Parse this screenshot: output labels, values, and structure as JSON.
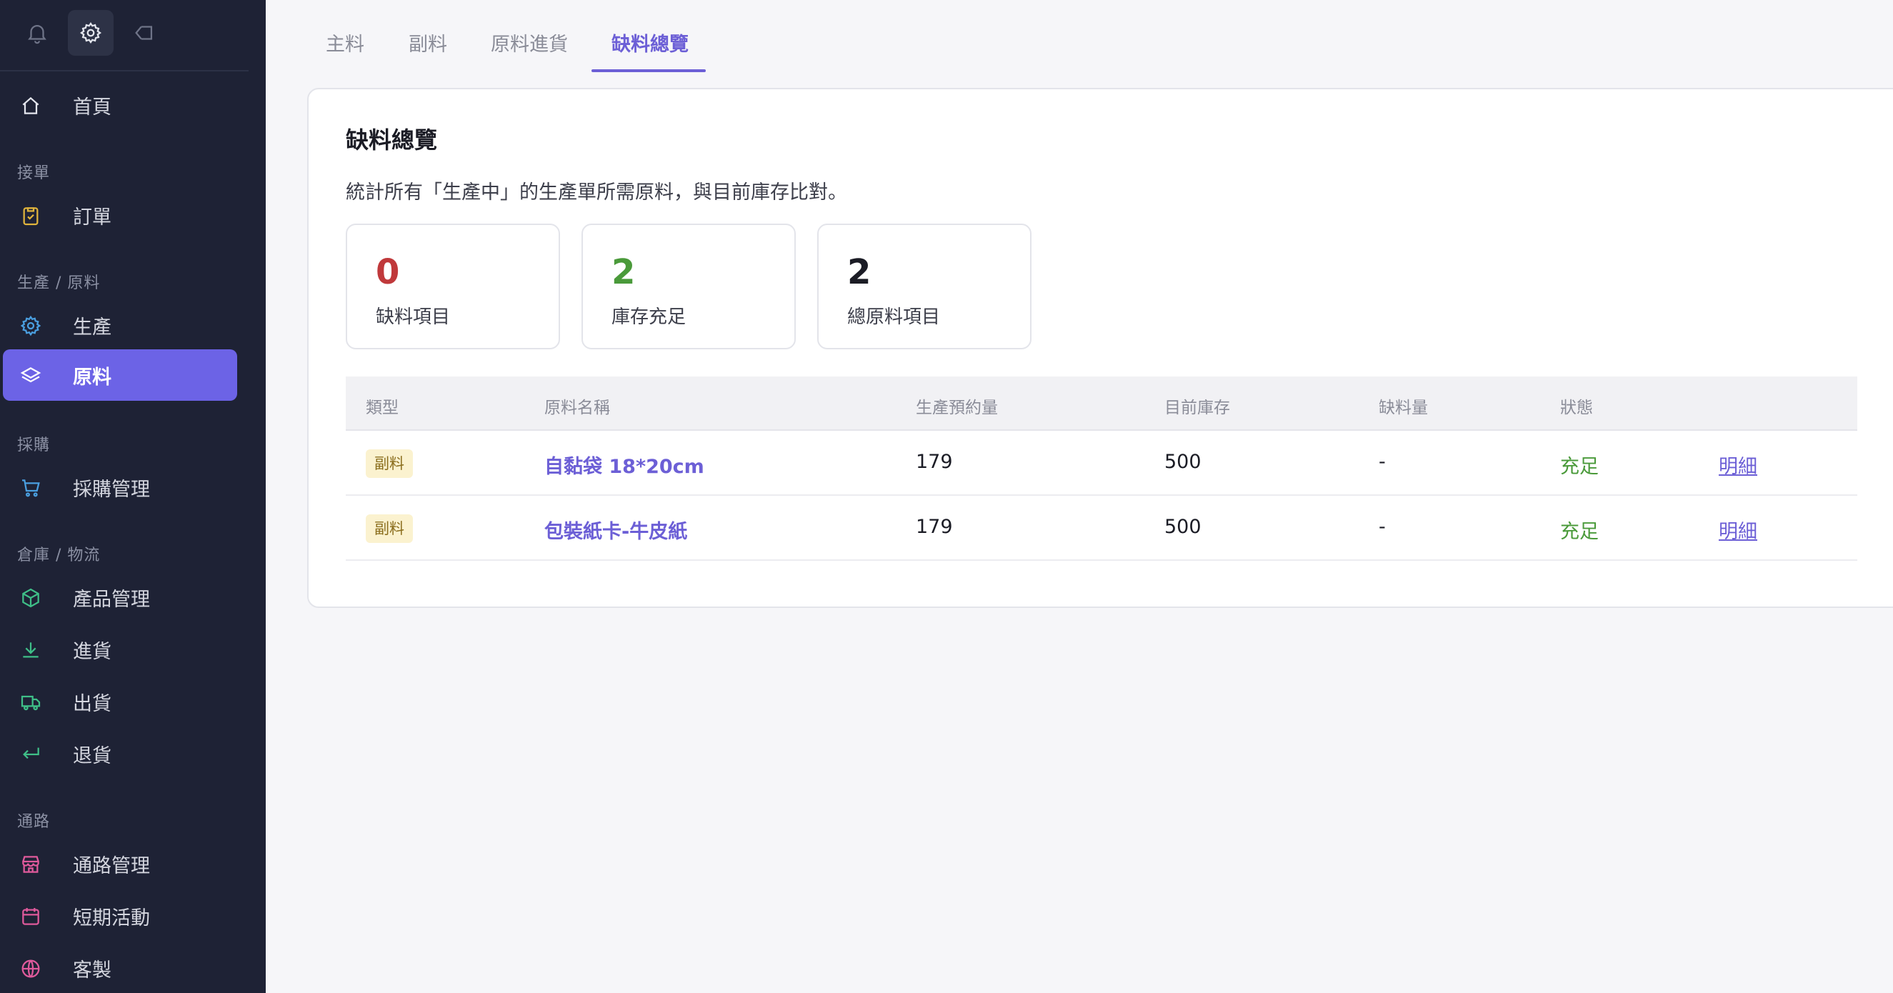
{
  "sidebar": {
    "home": "首頁",
    "sections": {
      "orders": "接單",
      "production": "生產 / 原料",
      "purchase": "採購",
      "warehouse": "倉庫 / 物流",
      "channels": "通路"
    },
    "items": {
      "orders": "訂單",
      "production": "生產",
      "materials": "原料",
      "purchase": "採購管理",
      "products": "產品管理",
      "inbound": "進貨",
      "outbound": "出貨",
      "returns": "退貨",
      "channels": "通路管理",
      "events": "短期活動",
      "custom": "客製"
    }
  },
  "tabs": [
    "主料",
    "副料",
    "原料進貨",
    "缺料總覽"
  ],
  "active_tab": "缺料總覽",
  "card": {
    "title": "缺料總覽",
    "description": "統計所有「生產中」的生產單所需原料，與目前庫存比對。"
  },
  "stats": [
    {
      "value": "0",
      "label": "缺料項目",
      "color": "#c0393b"
    },
    {
      "value": "2",
      "label": "庫存充足",
      "color": "#4a9a3a"
    },
    {
      "value": "2",
      "label": "總原料項目",
      "color": "#1b1c25"
    }
  ],
  "table": {
    "headers": [
      "類型",
      "原料名稱",
      "生產預約量",
      "目前庫存",
      "缺料量",
      "狀態"
    ],
    "rows": [
      {
        "type": "副料",
        "name": "自黏袋 18*20cm",
        "reserved": "179",
        "stock": "500",
        "shortage": "-",
        "status": "充足",
        "action": "明細"
      },
      {
        "type": "副料",
        "name": "包裝紙卡-牛皮紙",
        "reserved": "179",
        "stock": "500",
        "shortage": "-",
        "status": "充足",
        "action": "明細"
      }
    ]
  },
  "colors": {
    "sidebar_bg": "#1e2235",
    "accent": "#6c63e6",
    "shortage": "#c0393b",
    "sufficient": "#4a9a3a"
  }
}
